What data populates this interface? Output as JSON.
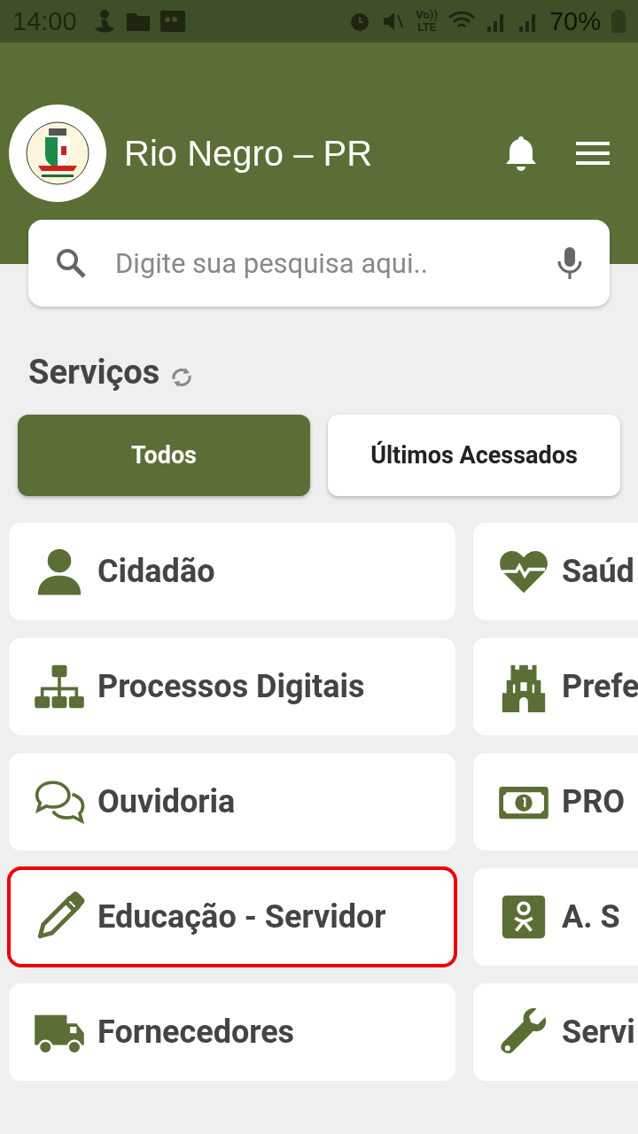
{
  "status_bar": {
    "time": "14:00",
    "network": "Vo))",
    "network_type": "LTE",
    "battery": "70%"
  },
  "header": {
    "title": "Rio Negro – PR"
  },
  "search": {
    "placeholder": "Digite sua pesquisa aqui.."
  },
  "section": {
    "title": "Serviços"
  },
  "tabs": [
    {
      "label": "Todos",
      "selected": true
    },
    {
      "label": "Últimos Acessados",
      "selected": false
    }
  ],
  "services": [
    {
      "label": "Cidadão",
      "highlighted": false
    },
    {
      "label": "Saúd",
      "highlighted": false
    },
    {
      "label": "Processos Digitais",
      "highlighted": false
    },
    {
      "label": "Prefe",
      "highlighted": false
    },
    {
      "label": "Ouvidoria",
      "highlighted": false
    },
    {
      "label": "PRO",
      "highlighted": false
    },
    {
      "label": "Educação - Servidor",
      "highlighted": true
    },
    {
      "label": "A. S",
      "highlighted": false
    },
    {
      "label": "Fornecedores",
      "highlighted": false
    },
    {
      "label": "Servi",
      "highlighted": false
    }
  ]
}
